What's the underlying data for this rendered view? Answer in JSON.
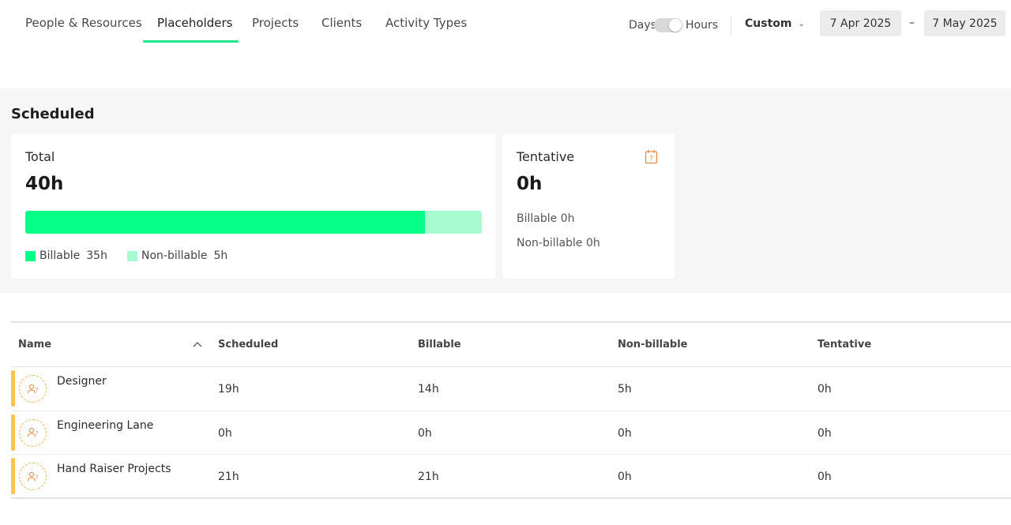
{
  "tabs": [
    {
      "label": "People & Resources"
    },
    {
      "label": "Placeholders"
    },
    {
      "label": "Projects"
    },
    {
      "label": "Clients"
    },
    {
      "label": "Activity Types"
    }
  ],
  "active_tab": "Placeholders",
  "unit_toggle": {
    "left_label": "Days",
    "right_label": "Hours",
    "selected": "Hours"
  },
  "range": {
    "label": "Custom",
    "start": "7 Apr 2025",
    "separator": "–",
    "end": "7 May 2025"
  },
  "scheduled": {
    "title": "Scheduled",
    "total": {
      "label": "Total",
      "value": "40h",
      "billable_fraction": 0.875,
      "legend": [
        {
          "label": "Billable",
          "value": "35h",
          "color": "#06ff86"
        },
        {
          "label": "Non-billable",
          "value": "5h",
          "color": "#a6fbd1"
        }
      ]
    },
    "tentative": {
      "label": "Tentative",
      "value": "0h",
      "billable": "Billable 0h",
      "non_billable": "Non-billable 0h",
      "icon": "calendar-question-icon"
    }
  },
  "table": {
    "headers": {
      "name": "Name",
      "scheduled": "Scheduled",
      "billable": "Billable",
      "non_billable": "Non-billable",
      "tentative": "Tentative"
    },
    "rows": [
      {
        "name": "Designer",
        "scheduled": "19h",
        "billable": "14h",
        "non_billable": "5h",
        "tentative": "0h"
      },
      {
        "name": "Engineering Lane",
        "scheduled": "0h",
        "billable": "0h",
        "non_billable": "0h",
        "tentative": "0h"
      },
      {
        "name": "Hand Raiser Projects",
        "scheduled": "21h",
        "billable": "21h",
        "non_billable": "0h",
        "tentative": "0h"
      }
    ]
  },
  "colors": {
    "accent": "#1ee88a",
    "billable": "#06ff86",
    "non_billable": "#a6fbd1",
    "placeholder": "#ffc44f",
    "tentative_icon": "#e98b45"
  }
}
